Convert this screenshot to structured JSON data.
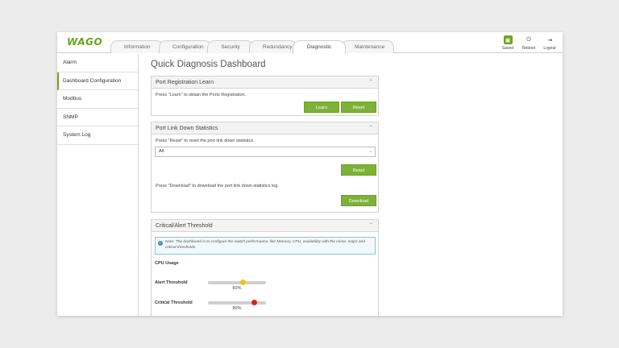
{
  "brand": "WAGO",
  "tabs": [
    {
      "label": "Information"
    },
    {
      "label": "Configuration"
    },
    {
      "label": "Security"
    },
    {
      "label": "Redundancy"
    },
    {
      "label": "Diagnostic"
    },
    {
      "label": "Maintenance"
    }
  ],
  "actions": {
    "saved": "Saved",
    "reboot": "Reboot",
    "logout": "Logout"
  },
  "sidebar": {
    "items": [
      {
        "label": "Alarm"
      },
      {
        "label": "Dashboard Configuration"
      },
      {
        "label": "Modbus"
      },
      {
        "label": "SNMP"
      },
      {
        "label": "System Log"
      }
    ]
  },
  "main": {
    "title": "Quick Diagnosis Dashboard",
    "port_registration": {
      "title": "Port Registration Learn",
      "text": "Press \"Learn\" to obtain the Ports Registration.",
      "learn_label": "Learn",
      "reset_label": "Reset"
    },
    "link_down": {
      "title": "Port Link Down Statistics",
      "reset_text": "Press \"Reset\" to reset the port link down statistics.",
      "select_value": "All",
      "reset_label": "Reset",
      "download_text": "Press \"Download\" to download the port link down statistics log.",
      "download_label": "Download"
    },
    "threshold": {
      "title": "Critical/Alert Threshold",
      "note": "Note: The dashboard is to configure the switch performance, like Memory, CPU, availability with the minor, major and critical thresholds.",
      "cpu_usage": "CPU Usage",
      "alert_label": "Alert Threshold",
      "alert_value": "60%",
      "alert_fraction": 0.6,
      "alert_color": "#e8c51f",
      "critical_label": "Critical Threshold",
      "critical_value": "80%",
      "critical_fraction": 0.8,
      "critical_color": "#d0281a"
    }
  },
  "colors": {
    "accent": "#6aa41e",
    "button": "#7eb139"
  }
}
